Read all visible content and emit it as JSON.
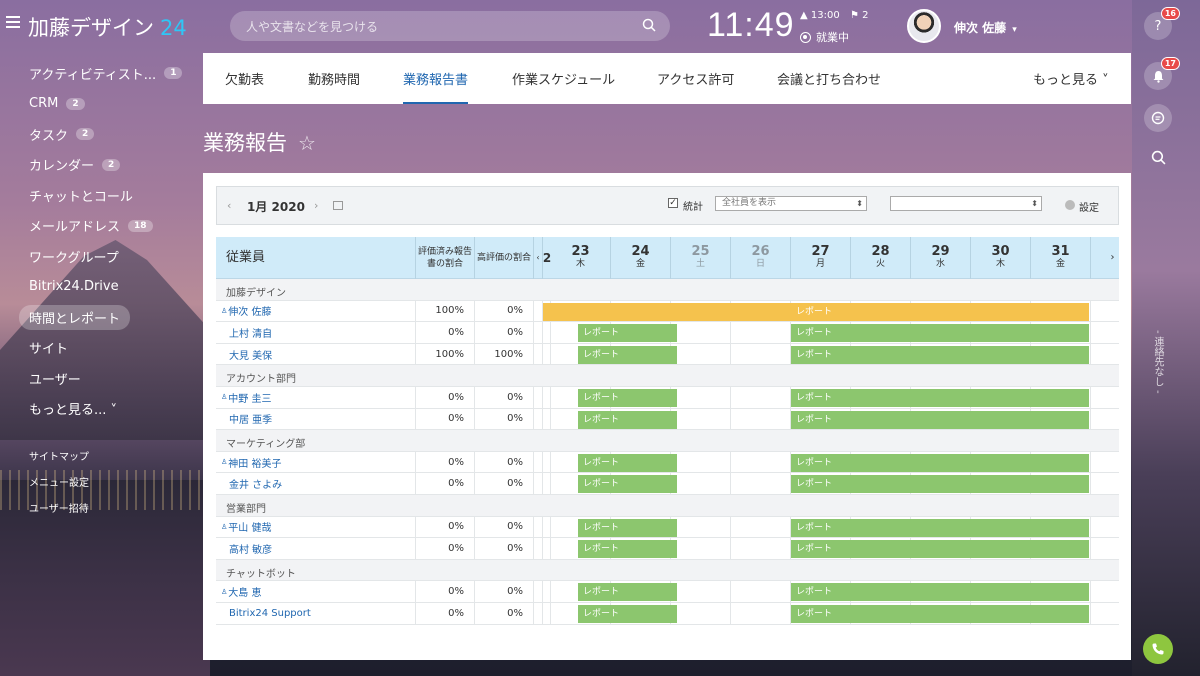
{
  "header": {
    "logo_text": "加藤デザイン",
    "logo_num": "24",
    "search_placeholder": "人や文書などを見つける",
    "time": "11:49",
    "alarm": "▲ 13:00",
    "flags": "⚑ 2",
    "work_status": "就業中",
    "user_name": "伸次 佐藤"
  },
  "sidebar": {
    "items": [
      {
        "label": "アクティビティスト...",
        "count": "1"
      },
      {
        "label": "CRM",
        "count": "2"
      },
      {
        "label": "タスク",
        "count": "2"
      },
      {
        "label": "カレンダー",
        "count": "2"
      },
      {
        "label": "チャットとコール",
        "count": ""
      },
      {
        "label": "メールアドレス",
        "count": "18"
      },
      {
        "label": "ワークグループ",
        "count": ""
      },
      {
        "label": "Bitrix24.Drive",
        "count": ""
      },
      {
        "label": "時間とレポート",
        "count": "",
        "active": true
      },
      {
        "label": "サイト",
        "count": ""
      },
      {
        "label": "ユーザー",
        "count": ""
      },
      {
        "label": "もっと見る... ˅",
        "count": ""
      }
    ],
    "sub_items": [
      "サイトマップ",
      "メニュー設定",
      "ユーザー招待"
    ]
  },
  "rightbar": {
    "help_badge": "16",
    "notif_badge": "17",
    "vertical_text": "- 連絡先なし -"
  },
  "tabs": [
    {
      "label": "欠勤表"
    },
    {
      "label": "勤務時間"
    },
    {
      "label": "業務報告書",
      "active": true
    },
    {
      "label": "作業スケジュール"
    },
    {
      "label": "アクセス許可"
    },
    {
      "label": "会議と打ち合わせ"
    },
    {
      "label": "もっと見る ˅"
    }
  ],
  "page": {
    "title": "業務報告"
  },
  "filters": {
    "month": "1月 2020",
    "stats_label": "統計",
    "stats_checked": "✓",
    "employee_select": "全社員を表示",
    "second_select": "",
    "settings": "設定"
  },
  "table": {
    "col_employee": "従業員",
    "col_rated": "評価済み報告書の割合",
    "col_high": "高評価の割合",
    "days": [
      {
        "d": "23",
        "w": "木",
        "weekend": false
      },
      {
        "d": "24",
        "w": "金",
        "weekend": false
      },
      {
        "d": "25",
        "w": "土",
        "weekend": true
      },
      {
        "d": "26",
        "w": "日",
        "weekend": true
      },
      {
        "d": "27",
        "w": "月",
        "weekend": false
      },
      {
        "d": "28",
        "w": "火",
        "weekend": false
      },
      {
        "d": "29",
        "w": "水",
        "weekend": false
      },
      {
        "d": "30",
        "w": "木",
        "weekend": false
      },
      {
        "d": "31",
        "w": "金",
        "weekend": false
      }
    ],
    "report_label": "レポート",
    "groups": [
      {
        "dept": "加藤デザイン",
        "rows": [
          {
            "name": "伸次 佐藤",
            "head": true,
            "rated": "100%",
            "high": "0%",
            "orange": true,
            "high_green": false
          },
          {
            "name": "上村 清自",
            "head": false,
            "rated": "0%",
            "high": "0%",
            "orange": false
          },
          {
            "name": "大見 美保",
            "head": false,
            "rated": "100%",
            "high": "100%",
            "orange": false
          }
        ]
      },
      {
        "dept": "アカウント部門",
        "rows": [
          {
            "name": "中野 圭三",
            "head": true,
            "rated": "0%",
            "high": "0%",
            "orange": false
          },
          {
            "name": "中居 亜季",
            "head": false,
            "rated": "0%",
            "high": "0%",
            "orange": false
          }
        ]
      },
      {
        "dept": "マーケティング部",
        "rows": [
          {
            "name": "神田 裕美子",
            "head": true,
            "rated": "0%",
            "high": "0%",
            "orange": false
          },
          {
            "name": "金井 さよみ",
            "head": false,
            "rated": "0%",
            "high": "0%",
            "orange": false
          }
        ]
      },
      {
        "dept": "営業部門",
        "rows": [
          {
            "name": "平山 健哉",
            "head": true,
            "rated": "0%",
            "high": "0%",
            "orange": false
          },
          {
            "name": "高村 敏彦",
            "head": false,
            "rated": "0%",
            "high": "0%",
            "orange": false
          }
        ]
      },
      {
        "dept": "チャットボット",
        "rows": [
          {
            "name": "大島 恵",
            "head": true,
            "rated": "0%",
            "high": "0%",
            "orange": false
          },
          {
            "name": "Bitrix24 Support",
            "head": false,
            "rated": "0%",
            "high": "0%",
            "orange": false
          }
        ]
      }
    ]
  }
}
